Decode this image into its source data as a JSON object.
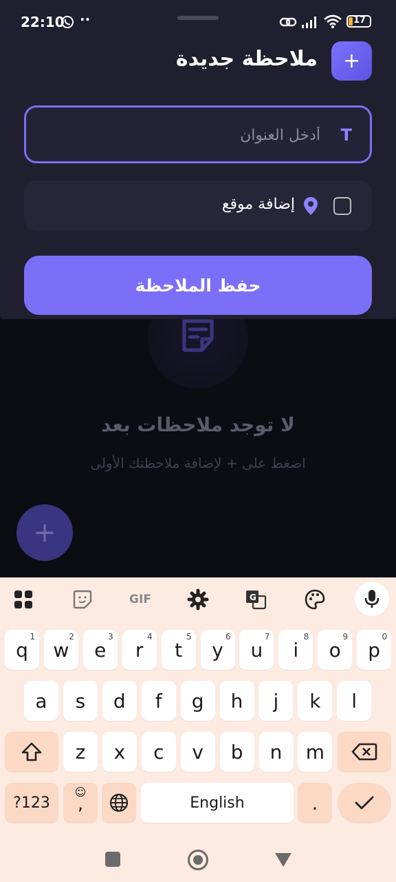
{
  "status_bar": {
    "time": "22:10",
    "dots": "··",
    "battery": "17",
    "icons": [
      "whatsapp-icon",
      "link-icon",
      "signal-icon",
      "wifi-icon",
      "battery-icon"
    ]
  },
  "sheet": {
    "title": "ملاحظة جديدة",
    "add_label": "+",
    "title_input": {
      "value": "",
      "placeholder": "أدخل العنوان",
      "icon": "T"
    },
    "location": {
      "label": "إضافة موقع",
      "checked": false
    },
    "save_label": "حفظ الملاحظة"
  },
  "empty_state": {
    "title": "لا توجد ملاحظات بعد",
    "subtitle": "اضغط على + لإضافة ملاحظتك الأولى"
  },
  "fab": {
    "label": "+"
  },
  "keyboard": {
    "toolbar": [
      "apps-icon",
      "sticker-icon",
      "GIF",
      "settings-icon",
      "translate-icon",
      "palette-icon",
      "mic-icon"
    ],
    "gif_label": "GIF",
    "row1": [
      {
        "k": "q",
        "h": "1"
      },
      {
        "k": "w",
        "h": "2"
      },
      {
        "k": "e",
        "h": "3"
      },
      {
        "k": "r",
        "h": "4"
      },
      {
        "k": "t",
        "h": "5"
      },
      {
        "k": "y",
        "h": "6"
      },
      {
        "k": "u",
        "h": "7"
      },
      {
        "k": "i",
        "h": "8"
      },
      {
        "k": "o",
        "h": "9"
      },
      {
        "k": "p",
        "h": "0"
      }
    ],
    "row2": [
      "a",
      "s",
      "d",
      "f",
      "g",
      "h",
      "j",
      "k",
      "l"
    ],
    "row3": [
      "z",
      "x",
      "c",
      "v",
      "b",
      "n",
      "m"
    ],
    "symbols_label": "?123",
    "comma_label": ",",
    "space_label": "English",
    "period_label": ".",
    "colors": {
      "bg": "#fdebe1",
      "key": "#ffffff",
      "dark_key": "#fbd9c5",
      "accent": "#7b6ff7"
    }
  }
}
